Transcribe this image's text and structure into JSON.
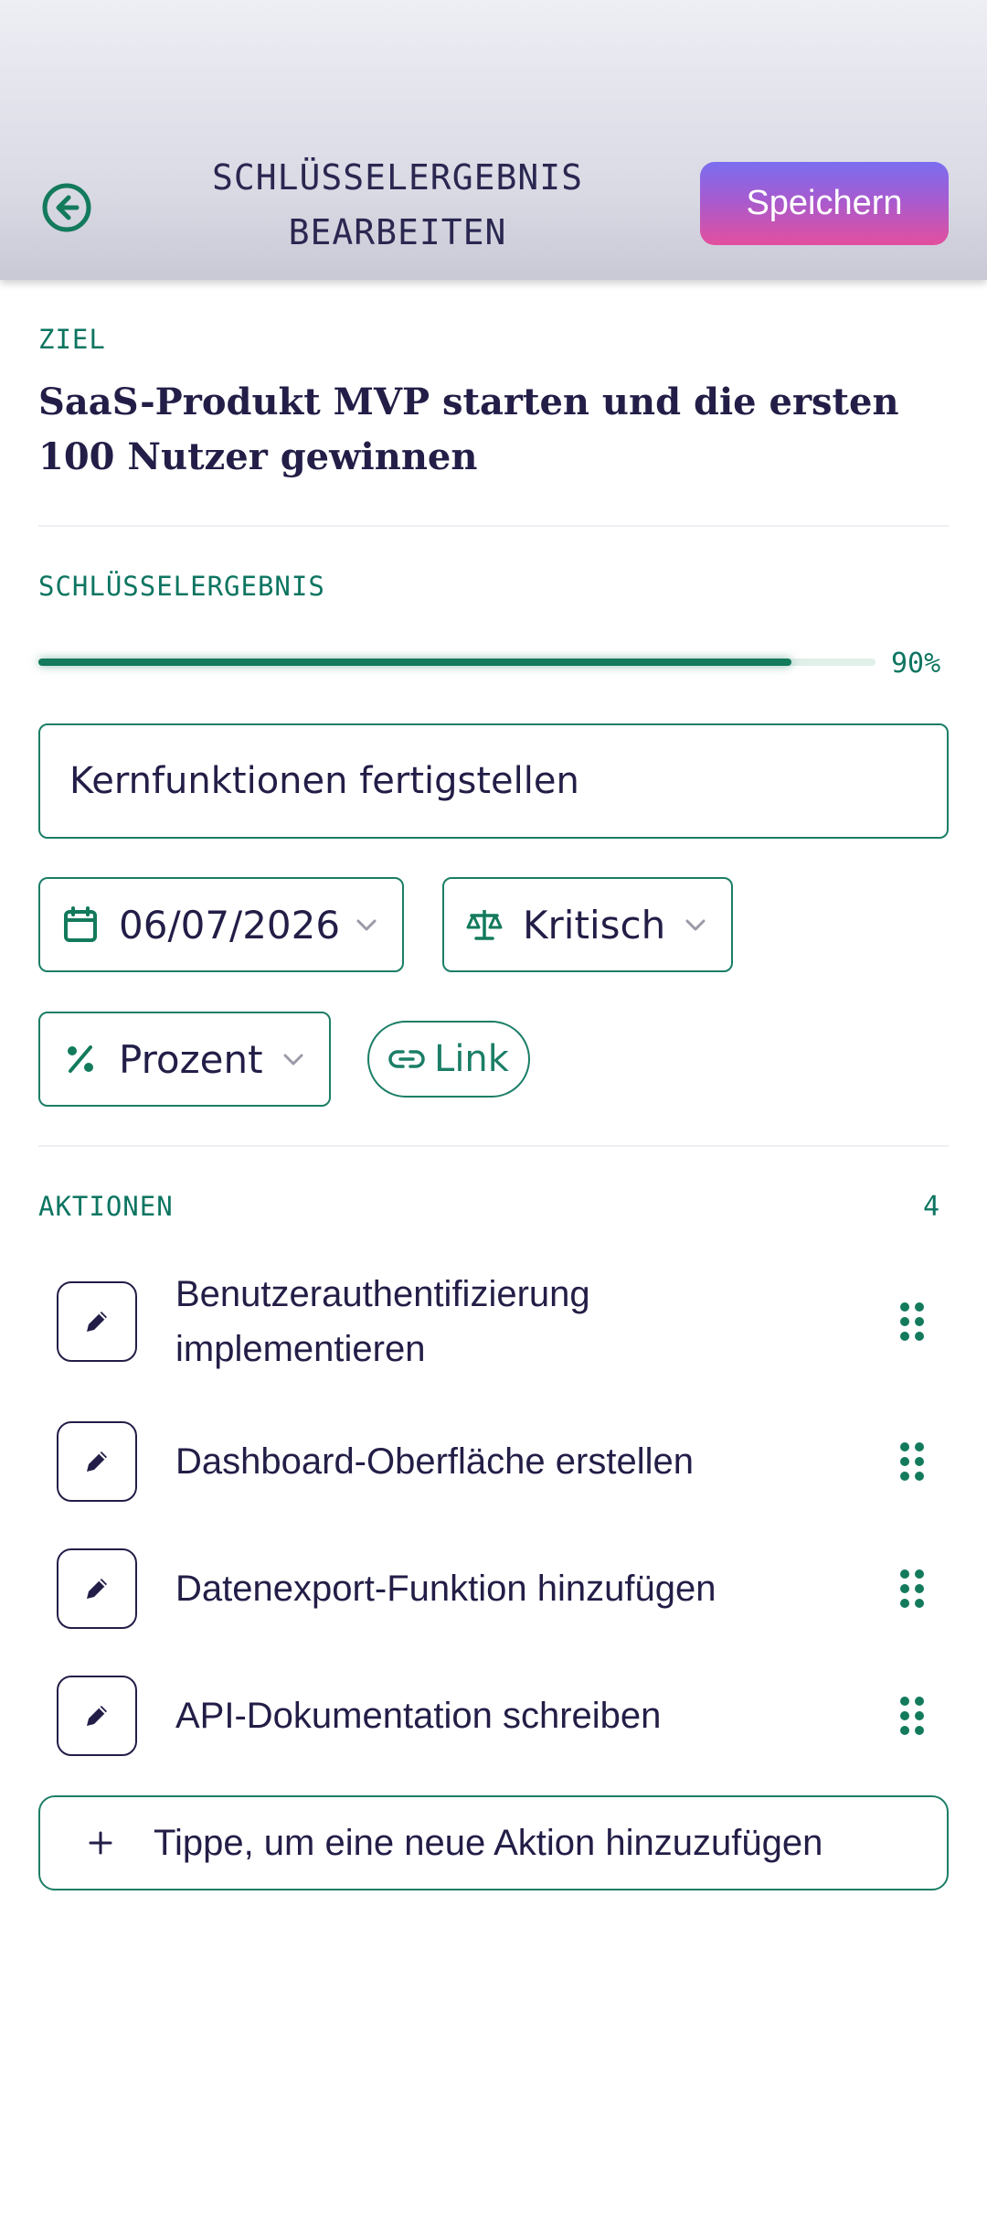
{
  "header": {
    "title_line1": "SCHLÜSSELERGEBNIS",
    "title_line2": "BEARBEITEN",
    "save_label": "Speichern",
    "back_icon": "back-arrow-circle-icon"
  },
  "goal": {
    "label": "ZIEL",
    "text": "SaaS-Produkt MVP starten und die ersten 100 Nutzer gewinnen"
  },
  "key_result": {
    "label": "SCHLÜSSELERGEBNIS",
    "progress_percent": 90,
    "progress_text": "90%",
    "title_value": "Kernfunktionen fertigstellen",
    "date": "06/07/2026",
    "priority": "Kritisch",
    "unit": "Prozent",
    "link_label": "Link"
  },
  "actions": {
    "label": "AKTIONEN",
    "count": "4",
    "items": [
      {
        "line1": "Benutzerauthentifizierung",
        "line2": "implementieren"
      },
      {
        "line1": "Dashboard-Oberfläche erstellen"
      },
      {
        "line1": "Datenexport-Funktion hinzufügen"
      },
      {
        "line1": "API-Dokumentation schreiben"
      }
    ],
    "add_placeholder": "Tippe, um eine neue Aktion hinzuzufügen"
  },
  "colors": {
    "accent": "#137a5c",
    "text": "#221e47",
    "save_gradient_top": "#7a6ef0",
    "save_gradient_bottom": "#e34f9e"
  }
}
